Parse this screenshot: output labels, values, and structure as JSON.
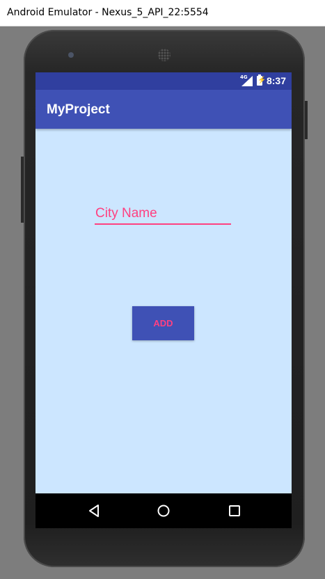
{
  "window": {
    "title": "Android Emulator - Nexus_5_API_22:5554"
  },
  "status_bar": {
    "network": "4G",
    "time": "8:37"
  },
  "app_bar": {
    "title": "MyProject"
  },
  "form": {
    "city_input": {
      "placeholder": "City Name",
      "value": ""
    },
    "add_button_label": "ADD"
  },
  "nav_bar": {
    "items": [
      "back-icon",
      "home-icon",
      "recents-icon"
    ]
  },
  "colors": {
    "primary": "#3f51b5",
    "primary_dark": "#303f9f",
    "accent": "#ff4081",
    "background": "#cce6ff"
  }
}
